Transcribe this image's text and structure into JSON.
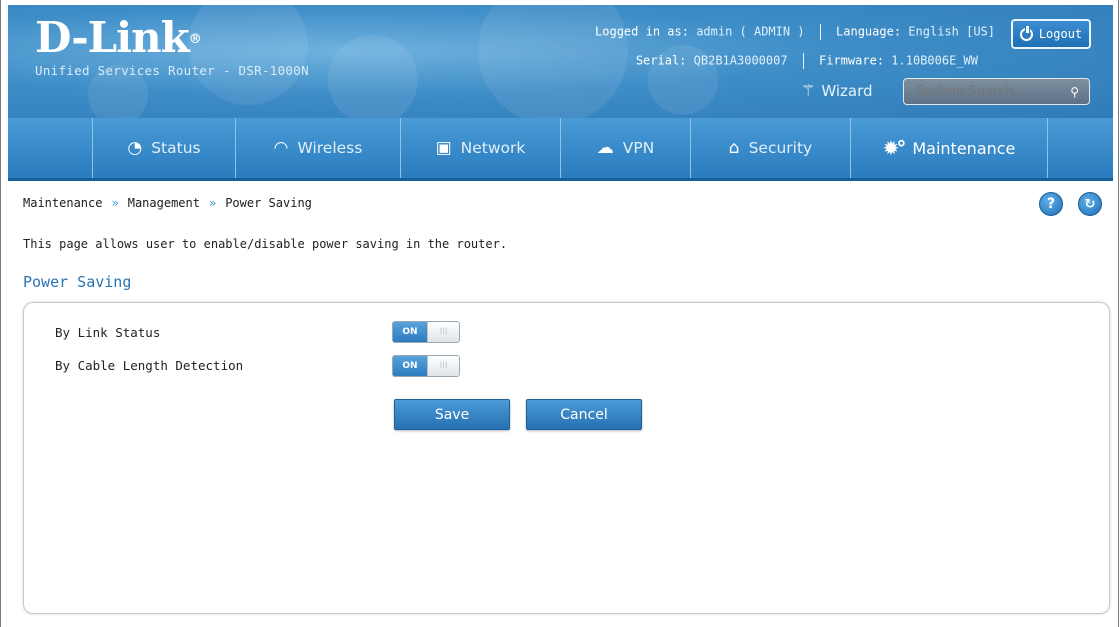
{
  "brand": {
    "logo": "D-Link",
    "trademark": "®",
    "tagline": "Unified Services Router - DSR-1000N"
  },
  "header": {
    "logged_in_label": "Logged in as:",
    "logged_in_value": "admin ( ADMIN )",
    "language_label": "Language:",
    "language_value": "English [US]",
    "serial_label": "Serial:",
    "serial_value": "QB2B1A3000007",
    "firmware_label": "Firmware:",
    "firmware_value": "1.10B006E_WW",
    "logout_label": "Logout",
    "wizard_label": "Wizard",
    "search_placeholder": "System Search..."
  },
  "nav": {
    "items": [
      {
        "label": "Status",
        "icon": "dashboard-icon"
      },
      {
        "label": "Wireless",
        "icon": "wifi-icon"
      },
      {
        "label": "Network",
        "icon": "computer-icon"
      },
      {
        "label": "VPN",
        "icon": "cloud-lock-icon"
      },
      {
        "label": "Security",
        "icon": "lock-icon"
      },
      {
        "label": "Maintenance",
        "icon": "gears-icon",
        "active": true
      }
    ]
  },
  "breadcrumb": [
    "Maintenance",
    "Management",
    "Power Saving"
  ],
  "page": {
    "description": "This page allows user to enable/disable power saving in the router.",
    "section_title": "Power Saving"
  },
  "settings": [
    {
      "label": "By Link Status",
      "on_text": "ON",
      "off_text": "III",
      "value": "on"
    },
    {
      "label": "By Cable Length Detection",
      "on_text": "ON",
      "off_text": "III",
      "value": "on"
    }
  ],
  "buttons": {
    "save": "Save",
    "cancel": "Cancel"
  },
  "colors": {
    "header_blue": "#3e8dc7",
    "nav_blue": "#2a7cbe",
    "accent_blue": "#2a73b3"
  }
}
